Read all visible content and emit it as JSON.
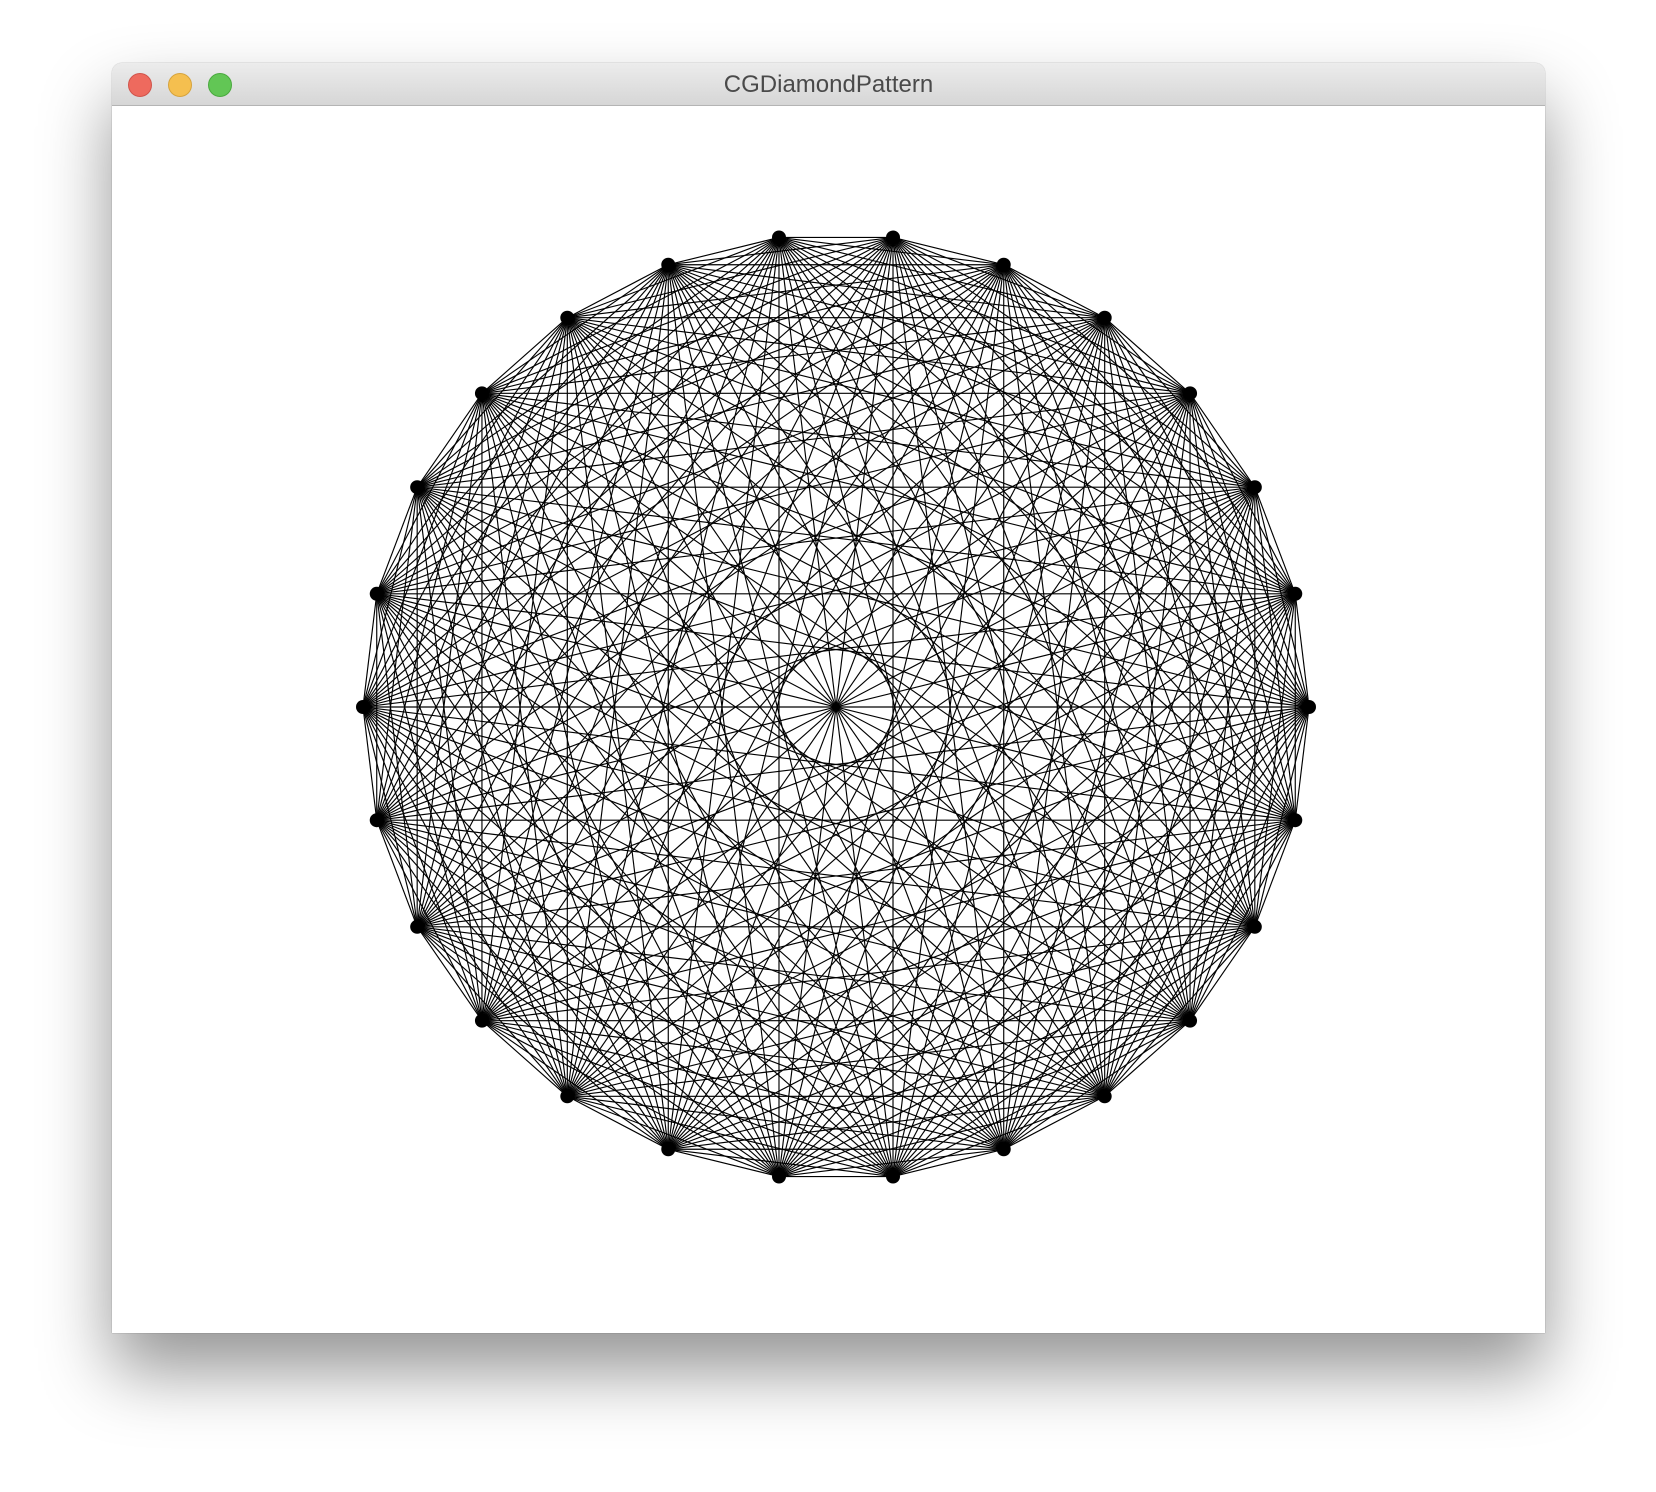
{
  "window": {
    "title": "CGDiamondPattern",
    "buttons": {
      "close": "close-button",
      "minimize": "minimize-button",
      "zoom": "zoom-button"
    }
  },
  "pattern": {
    "vertex_count": 26,
    "stroke_color": "#000000",
    "background_color": "#ffffff"
  },
  "colors": {
    "close": "#ee6a5e",
    "minimize": "#f5bf4f",
    "zoom": "#62c655"
  }
}
